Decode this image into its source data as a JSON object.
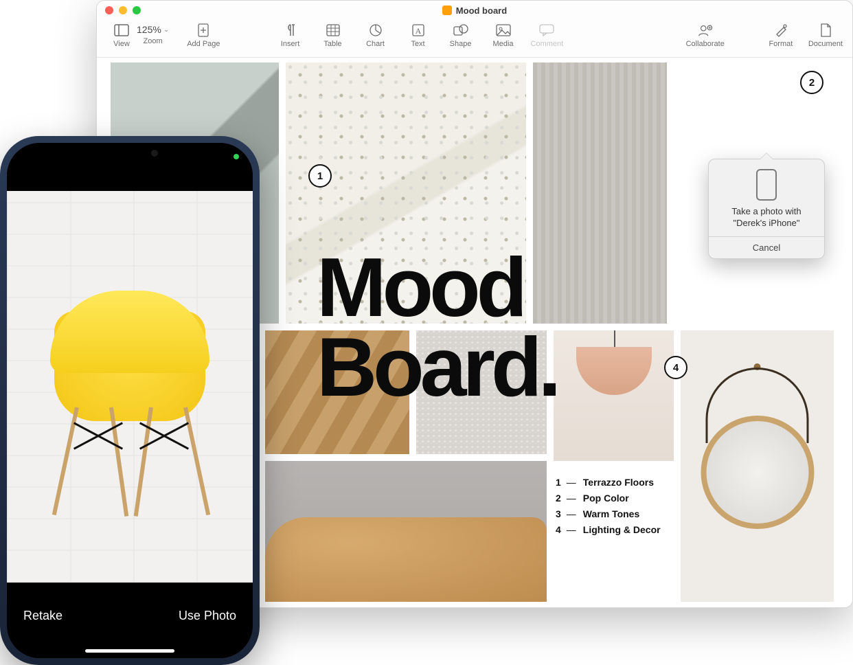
{
  "window": {
    "title": "Mood board"
  },
  "toolbar": {
    "view": "View",
    "zoom_value": "125%",
    "zoom_label": "Zoom",
    "add_page": "Add Page",
    "insert": "Insert",
    "table": "Table",
    "chart": "Chart",
    "text": "Text",
    "shape": "Shape",
    "media": "Media",
    "comment": "Comment",
    "collaborate": "Collaborate",
    "format": "Format",
    "document": "Document"
  },
  "doc": {
    "heading_line1": "Mood",
    "heading_line2": "Board.",
    "annotations": {
      "a1": "1",
      "a2": "2",
      "a4": "4"
    },
    "legend": [
      {
        "n": "1",
        "label": "Terrazzo Floors"
      },
      {
        "n": "2",
        "label": "Pop Color"
      },
      {
        "n": "3",
        "label": "Warm Tones"
      },
      {
        "n": "4",
        "label": "Lighting & Decor"
      }
    ]
  },
  "popover": {
    "text": "Take a photo with \"Derek's iPhone\"",
    "cancel": "Cancel"
  },
  "phone": {
    "retake": "Retake",
    "use_photo": "Use Photo"
  }
}
